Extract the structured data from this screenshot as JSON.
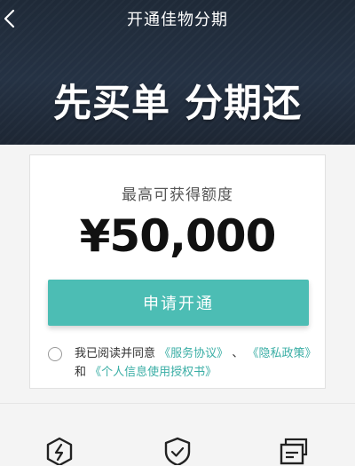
{
  "nav": {
    "title": "开通佳物分期",
    "back_icon": "chevron-left-icon"
  },
  "hero": {
    "headline": "先买单 分期还"
  },
  "card": {
    "limit_label": "最高可获得额度",
    "amount": "¥50,000"
  },
  "apply_button": {
    "label": "申请开通"
  },
  "agreement": {
    "prefix": "我已阅读并同意",
    "service_agreement": "《服务协议》",
    "separator": "、",
    "privacy_policy": "《隐私政策》",
    "and": "和",
    "authorization": "《个人信息使用授权书》",
    "checked": false
  },
  "features": [
    {
      "icon": "lightning-hexagon-icon"
    },
    {
      "icon": "shield-check-icon"
    },
    {
      "icon": "card-stack-icon"
    }
  ],
  "colors": {
    "header_bg": "#1f2a38",
    "accent": "#4cbdb4",
    "link": "#3aaea5"
  }
}
